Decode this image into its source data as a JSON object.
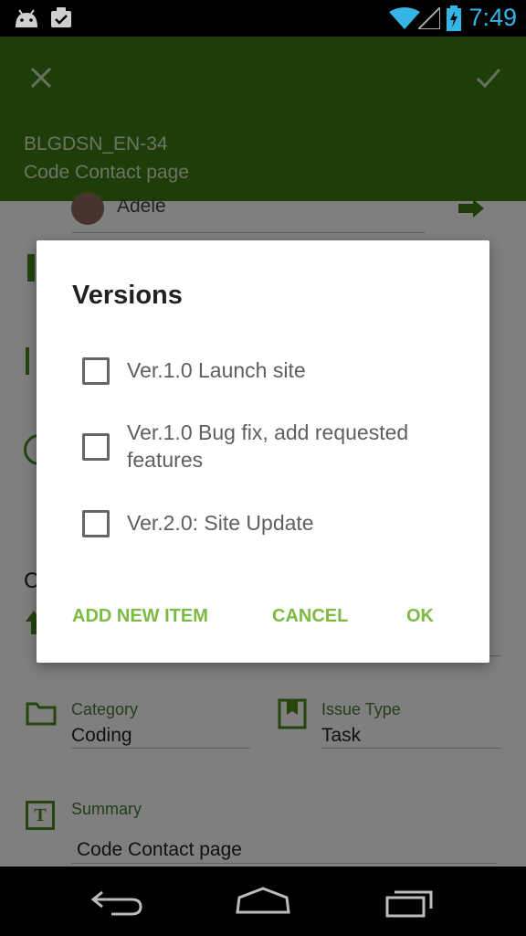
{
  "status_bar": {
    "time": "7:49"
  },
  "app_bar": {
    "issue_key": "BLGDSN_EN-34",
    "issue_title": "Code Contact page"
  },
  "background_form": {
    "assignee": "Adele",
    "category_label": "Category",
    "category_value": "Coding",
    "issue_type_label": "Issue Type",
    "issue_type_value": "Task",
    "summary_label": "Summary",
    "summary_value": "Code Contact page"
  },
  "dialog": {
    "title": "Versions",
    "options": [
      {
        "label": "Ver.1.0 Launch site",
        "checked": false
      },
      {
        "label": "Ver.1.0 Bug fix, add requested features",
        "checked": false
      },
      {
        "label": "Ver.2.0: Site Update",
        "checked": false
      }
    ],
    "buttons": {
      "add_new": "ADD NEW ITEM",
      "cancel": "CANCEL",
      "ok": "OK"
    }
  },
  "colors": {
    "app_bar": "#3f7a12",
    "accent": "#7cbb42",
    "status_time": "#33b5e5"
  }
}
